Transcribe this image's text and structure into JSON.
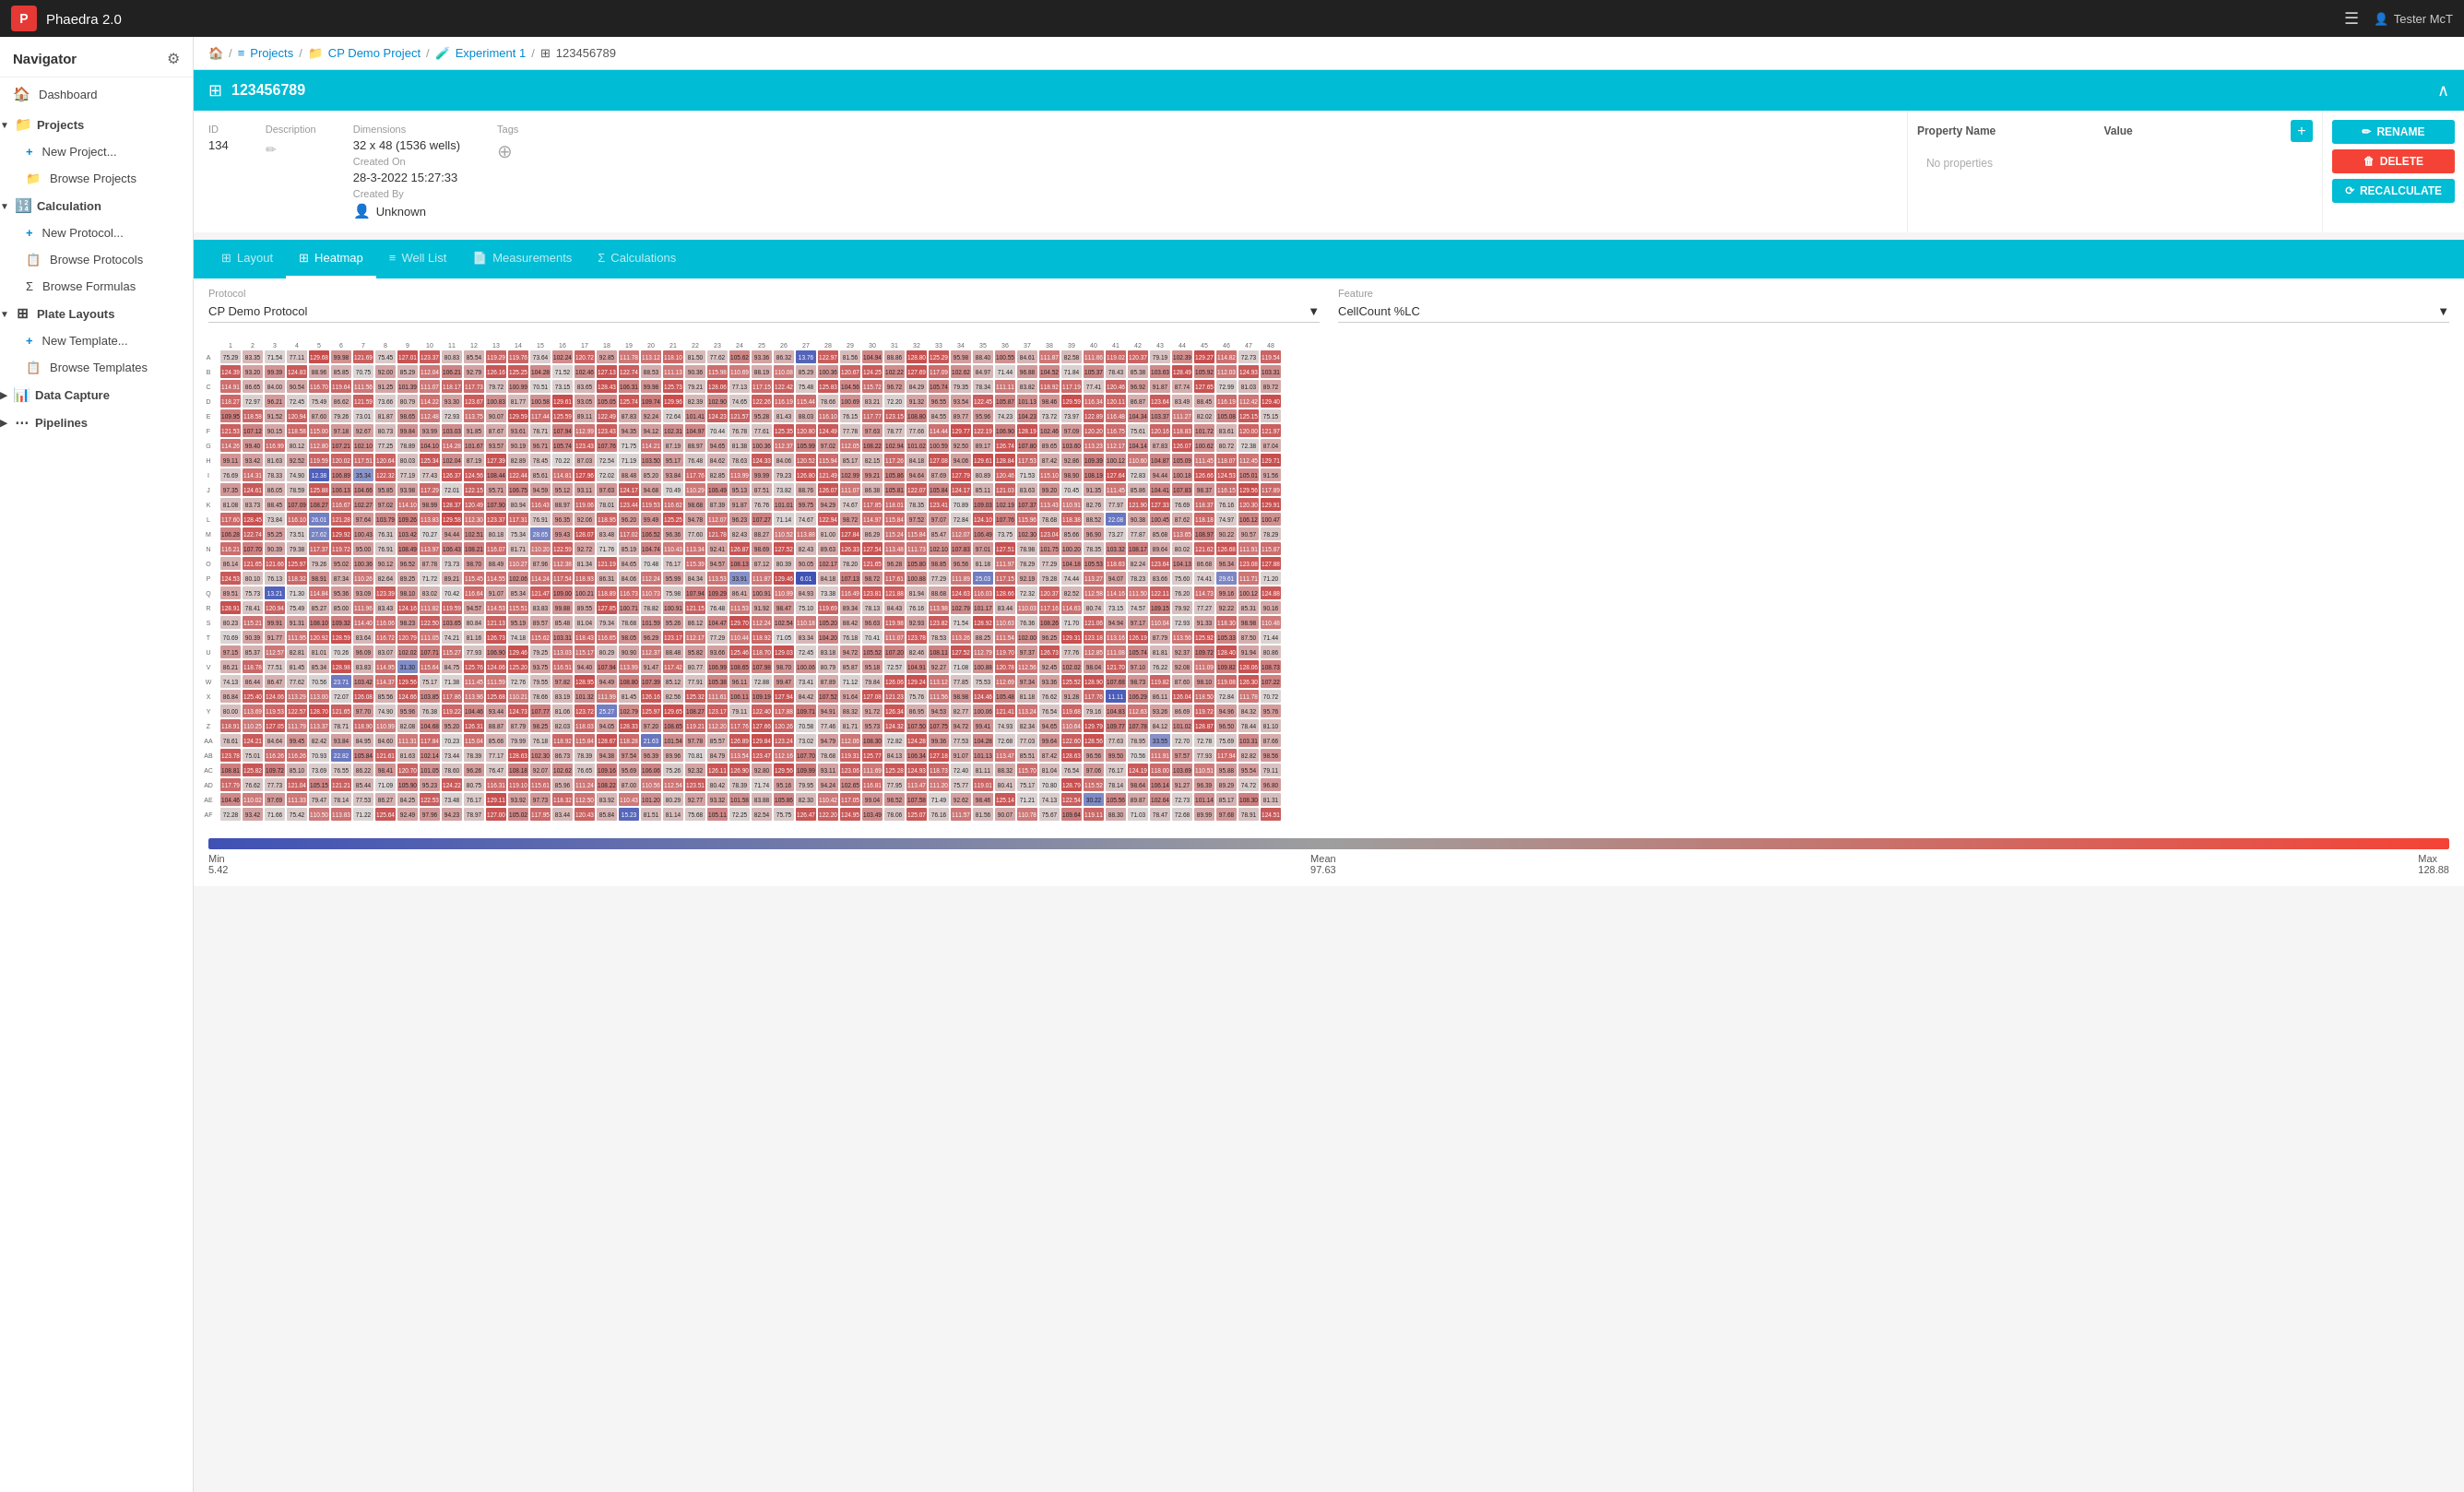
{
  "topbar": {
    "logo": "P",
    "title": "Phaedra 2.0",
    "menu_icon": "☰",
    "user_icon": "👤",
    "user_name": "Tester McT"
  },
  "sidebar": {
    "title": "Navigator",
    "gear_icon": "⚙",
    "sections": [
      {
        "id": "dashboard",
        "label": "Dashboard",
        "icon": "🏠",
        "type": "item",
        "active": false
      },
      {
        "id": "projects",
        "label": "Projects",
        "icon": "📁",
        "type": "parent",
        "expanded": true,
        "children": [
          {
            "id": "new-project",
            "label": "New Project...",
            "icon": "+"
          },
          {
            "id": "browse-projects",
            "label": "Browse Projects",
            "icon": "📁"
          }
        ]
      },
      {
        "id": "calculation",
        "label": "Calculation",
        "icon": "🔢",
        "type": "parent",
        "expanded": true,
        "children": [
          {
            "id": "new-protocol",
            "label": "New Protocol...",
            "icon": "+"
          },
          {
            "id": "browse-protocols",
            "label": "Browse Protocols",
            "icon": "📋"
          },
          {
            "id": "browse-formulas",
            "label": "Browse Formulas",
            "icon": "Σ"
          }
        ]
      },
      {
        "id": "plate-layouts",
        "label": "Plate Layouts",
        "icon": "⊞",
        "type": "parent",
        "expanded": true,
        "children": [
          {
            "id": "new-template",
            "label": "New Template...",
            "icon": "+"
          },
          {
            "id": "browse-templates",
            "label": "Browse Templates",
            "icon": "📋"
          }
        ]
      },
      {
        "id": "data-capture",
        "label": "Data Capture",
        "icon": "📊",
        "type": "item",
        "active": false
      },
      {
        "id": "pipelines",
        "label": "Pipelines",
        "icon": "⋯",
        "type": "item",
        "active": false
      }
    ]
  },
  "breadcrumb": {
    "home_icon": "🏠",
    "items": [
      {
        "label": "Projects",
        "icon": "≡"
      },
      {
        "label": "CP Demo Project",
        "icon": "📁"
      },
      {
        "label": "Experiment 1",
        "icon": "🧪"
      },
      {
        "label": "123456789",
        "icon": "⊞"
      }
    ]
  },
  "plate": {
    "title": "123456789",
    "id_label": "ID",
    "id_value": "134",
    "description_label": "Description",
    "dimensions_label": "Dimensions",
    "dimensions_value": "32 x 48 (1536 wells)",
    "created_on_label": "Created On",
    "created_on_value": "28-3-2022 15:27:33",
    "created_by_label": "Created By",
    "created_by_value": "Unknown",
    "tags_label": "Tags",
    "no_properties": "No properties",
    "property_name_col": "Property Name",
    "value_col": "Value",
    "rename_label": "RENAME",
    "delete_label": "DELETE",
    "recalculate_label": "RECALCULATE"
  },
  "tabs": [
    {
      "id": "layout",
      "label": "Layout",
      "icon": "⊞",
      "active": false
    },
    {
      "id": "heatmap",
      "label": "Heatmap",
      "icon": "⊞",
      "active": true
    },
    {
      "id": "well-list",
      "label": "Well List",
      "icon": "≡",
      "active": false
    },
    {
      "id": "measurements",
      "label": "Measurements",
      "icon": "📄",
      "active": false
    },
    {
      "id": "calculations",
      "label": "Calculations",
      "icon": "Σ",
      "active": false
    }
  ],
  "heatmap": {
    "protocol_label": "Protocol",
    "protocol_value": "CP Demo Protocol",
    "feature_label": "Feature",
    "feature_value": "CellCount %LC",
    "min_label": "Min",
    "min_value": "5.42",
    "mean_label": "Mean",
    "mean_value": "97.63",
    "max_label": "Max",
    "max_value": "128.88",
    "row_labels": [
      "A",
      "B",
      "C",
      "D",
      "E",
      "F",
      "G",
      "H",
      "I",
      "J",
      "K",
      "L",
      "M",
      "N",
      "O",
      "P",
      "Q",
      "R",
      "S",
      "T",
      "U",
      "V",
      "W",
      "X",
      "Y",
      "Z",
      "AA",
      "AB",
      "AC",
      "AD",
      "AE",
      "AF"
    ],
    "col_labels": [
      "1",
      "2",
      "3",
      "4",
      "5",
      "6",
      "7",
      "8",
      "9",
      "10",
      "11",
      "12",
      "13",
      "14",
      "15",
      "16",
      "17",
      "18",
      "19",
      "20",
      "21",
      "22",
      "23",
      "24",
      "25",
      "26",
      "27",
      "28",
      "29",
      "30",
      "31",
      "32",
      "33",
      "34",
      "35",
      "36",
      "37",
      "38",
      "39",
      "40",
      "41",
      "42",
      "43",
      "44",
      "45",
      "46",
      "47",
      "48"
    ]
  }
}
